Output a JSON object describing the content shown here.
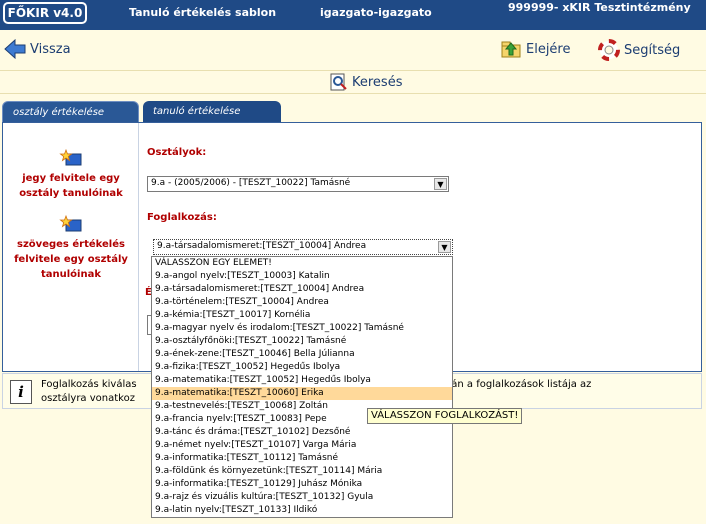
{
  "topbar": {
    "logo": "FŐKIR v4.0",
    "template": "Tanuló értékelés sablon",
    "user": "igazgato-igazgato",
    "institution": "999999- xKIR Tesztintézmény"
  },
  "toolbar": {
    "back_label": "Vissza",
    "home_label": "Elejére",
    "help_label": "Segítség",
    "search_label": "Keresés"
  },
  "tabs": [
    {
      "label": "osztály értékelése",
      "active": true
    },
    {
      "label": "tanuló értékelése",
      "active": false
    }
  ],
  "sidebar": {
    "items": [
      {
        "label": "jegy felvitele egy osztály tanulóinak",
        "icon": "star-icon"
      },
      {
        "label": "szöveges értékelés felvitele egy osztály tanulóinak",
        "icon": "star-icon"
      }
    ]
  },
  "form": {
    "class_label": "Osztályok:",
    "class_value": "9.a - (2005/2006) - [TESZT_10022] Tamásné",
    "subject_label": "Foglalkozás:",
    "subject_value": "9.a-társadalomismeret:[TESZT_10004] Andrea",
    "partial_label": "É"
  },
  "info": {
    "text_left": "Foglalkozás kiválas",
    "text_right": "tása nyomán a foglalkozások listája az",
    "text_line2": "osztályra vonatkoz"
  },
  "dropdown": {
    "options": [
      "VÁLASSZON EGY ELEMET!",
      "9.a-angol nyelv:[TESZT_10003] Katalin",
      "9.a-társadalomismeret:[TESZT_10004] Andrea",
      "9.a-történelem:[TESZT_10004] Andrea",
      "9.a-kémia:[TESZT_10017] Kornélia",
      "9.a-magyar nyelv és irodalom:[TESZT_10022] Tamásné",
      "9.a-osztályfőnöki:[TESZT_10022] Tamásné",
      "9.a-ének-zene:[TESZT_10046] Bella Júlianna",
      "9.a-fizika:[TESZT_10052] Hegedűs Ibolya",
      "9.a-matematika:[TESZT_10052] Hegedűs Ibolya",
      "9.a-matematika:[TESZT_10060] Erika",
      "9.a-testnevelés:[TESZT_10068] Zoltán",
      "9.a-francia nyelv:[TESZT_10083] Pepe",
      "9.a-tánc és dráma:[TESZT_10102] Dezsőné",
      "9.a-német nyelv:[TESZT_10107] Varga Mária",
      "9.a-informatika:[TESZT_10112] Tamásné",
      "9.a-földünk és környezetünk:[TESZT_10114] Mária",
      "9.a-informatika:[TESZT_10129] Juhász Mónika",
      "9.a-rajz és vizuális kultúra:[TESZT_10132] Gyula",
      "9.a-latin nyelv:[TESZT_10133] Ildikó"
    ],
    "highlighted_index": 10
  },
  "tooltip": "VÁLASSZON FOGLALKOZÁST!",
  "colors": {
    "topbar": "#1f4a86",
    "accent_red": "#b00000",
    "page_bg": "#fffbe3",
    "highlight": "#ffd99a"
  }
}
